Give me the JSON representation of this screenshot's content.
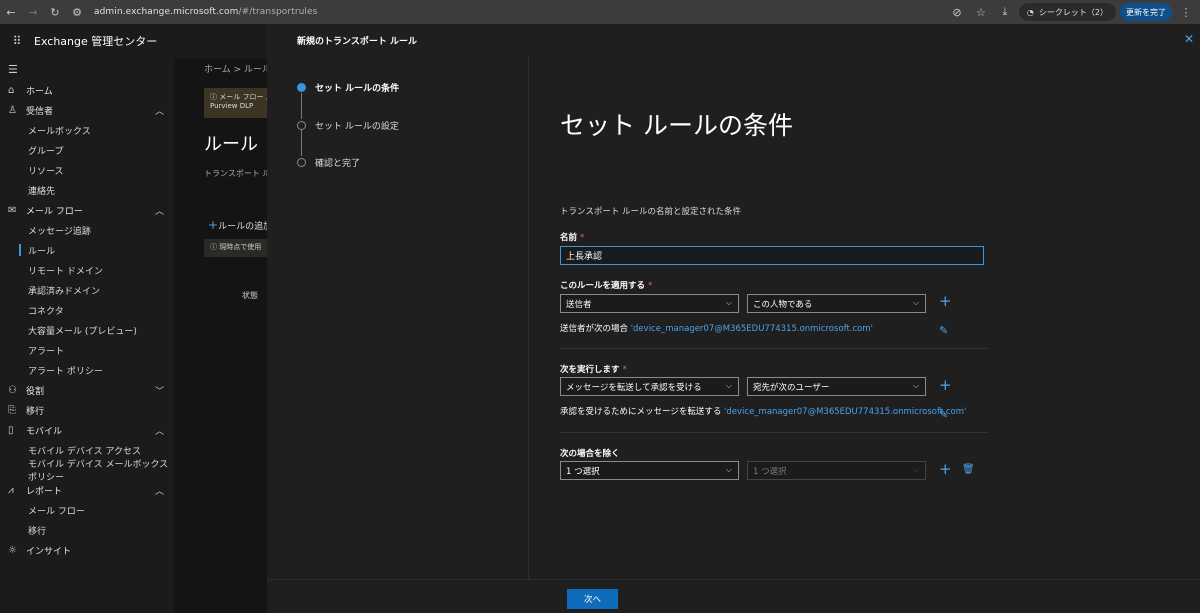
{
  "browser": {
    "url_host": "admin.exchange.microsoft.com",
    "url_path": "/#/transportrules",
    "incognito_label": "シークレット（2）",
    "update_label": "更新を完了"
  },
  "app": {
    "title": "Exchange 管理センター"
  },
  "sidebar": {
    "home": "ホーム",
    "recipients": "受信者",
    "recipients_items": [
      "メールボックス",
      "グループ",
      "リソース",
      "連絡先"
    ],
    "mailflow": "メール フロー",
    "mailflow_items": [
      "メッセージ追跡",
      "ルール",
      "リモート ドメイン",
      "承認済みドメイン",
      "コネクタ",
      "大容量メール (プレビュー)",
      "アラート",
      "アラート ポリシー"
    ],
    "roles": "役割",
    "migration": "移行",
    "mobile": "モバイル",
    "mobile_items": [
      "モバイル デバイス アクセス",
      "モバイル デバイス メールボックス ポリシー"
    ],
    "reports": "レポート",
    "reports_items": [
      "メール フロー",
      "移行"
    ],
    "insights": "インサイト"
  },
  "bg": {
    "breadcrumb": "ホーム  >  ルール",
    "banner": "メール フロー ルール",
    "banner2": "Purview DLP",
    "title": "ルール",
    "desc": "トランスポート ルー",
    "add": "ルールの追加",
    "info": "現時点で使用",
    "col": "状態"
  },
  "panel": {
    "header": "新規のトランスポート ルール",
    "steps": [
      "セット ルールの条件",
      "セット ルールの設定",
      "確認と完了"
    ],
    "heading": "セット ルールの条件",
    "subtitle": "トランスポート ルールの名前と設定された条件",
    "name_label": "名前",
    "name_value": "上長承認",
    "apply_label": "このルールを適用する",
    "apply_select1": "送信者",
    "apply_select2": "この人物である",
    "apply_cond_prefix": "送信者が次の場合 ",
    "apply_cond_link": "'device_manager07@M365EDU774315.onmicrosoft.com'",
    "do_label": "次を実行します",
    "do_select1": "メッセージを転送して承認を受ける",
    "do_select2": "宛先が次のユーザー",
    "do_cond_prefix": "承認を受けるためにメッセージを転送する ",
    "do_cond_link": "'device_manager07@M365EDU774315.onmicrosoft.com'",
    "except_label": "次の場合を除く",
    "except_select1": "1 つ選択",
    "except_select2": "1 つ選択",
    "required_mark": "*",
    "next_button": "次へ"
  }
}
